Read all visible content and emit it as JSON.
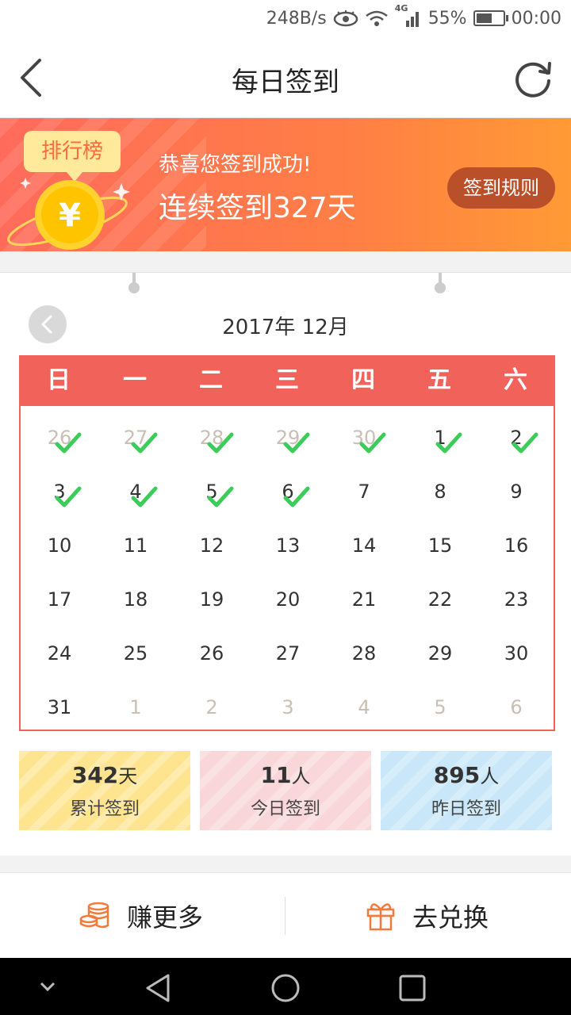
{
  "status_bar": {
    "net_speed": "248B/s",
    "network": "4G",
    "battery": "55%",
    "time": "00:00"
  },
  "header": {
    "title": "每日签到"
  },
  "banner": {
    "rank_label": "排行榜",
    "congrats": "恭喜您签到成功!",
    "streak_text": "连续签到327天",
    "rules_button": "签到规则"
  },
  "calendar": {
    "month_label": "2017年 12月",
    "weekdays": [
      "日",
      "一",
      "二",
      "三",
      "四",
      "五",
      "六"
    ],
    "weeks": [
      [
        {
          "d": "26",
          "other": true,
          "checked": true
        },
        {
          "d": "27",
          "other": true,
          "checked": true
        },
        {
          "d": "28",
          "other": true,
          "checked": true
        },
        {
          "d": "29",
          "other": true,
          "checked": true
        },
        {
          "d": "30",
          "other": true,
          "checked": true
        },
        {
          "d": "1",
          "other": false,
          "checked": true
        },
        {
          "d": "2",
          "other": false,
          "checked": true
        }
      ],
      [
        {
          "d": "3",
          "other": false,
          "checked": true
        },
        {
          "d": "4",
          "other": false,
          "checked": true
        },
        {
          "d": "5",
          "other": false,
          "checked": true
        },
        {
          "d": "6",
          "other": false,
          "checked": true
        },
        {
          "d": "7",
          "other": false,
          "checked": false
        },
        {
          "d": "8",
          "other": false,
          "checked": false
        },
        {
          "d": "9",
          "other": false,
          "checked": false
        }
      ],
      [
        {
          "d": "10"
        },
        {
          "d": "11"
        },
        {
          "d": "12"
        },
        {
          "d": "13"
        },
        {
          "d": "14"
        },
        {
          "d": "15"
        },
        {
          "d": "16"
        }
      ],
      [
        {
          "d": "17"
        },
        {
          "d": "18"
        },
        {
          "d": "19"
        },
        {
          "d": "20"
        },
        {
          "d": "21"
        },
        {
          "d": "22"
        },
        {
          "d": "23"
        }
      ],
      [
        {
          "d": "24"
        },
        {
          "d": "25"
        },
        {
          "d": "26"
        },
        {
          "d": "27"
        },
        {
          "d": "28"
        },
        {
          "d": "29"
        },
        {
          "d": "30"
        }
      ],
      [
        {
          "d": "31"
        },
        {
          "d": "1",
          "other": true
        },
        {
          "d": "2",
          "other": true
        },
        {
          "d": "3",
          "other": true
        },
        {
          "d": "4",
          "other": true
        },
        {
          "d": "5",
          "other": true
        },
        {
          "d": "6",
          "other": true
        }
      ]
    ]
  },
  "stats": [
    {
      "value": "342",
      "unit": "天",
      "label": "累计签到"
    },
    {
      "value": "11",
      "unit": "人",
      "label": "今日签到"
    },
    {
      "value": "895",
      "unit": "人",
      "label": "昨日签到"
    }
  ],
  "actions": {
    "earn_more": "赚更多",
    "redeem": "去兑换"
  },
  "colors": {
    "accent": "#f0625a",
    "check": "#3ccc5a",
    "banner_start": "#ff6b5b",
    "banner_end": "#ff9a35"
  }
}
